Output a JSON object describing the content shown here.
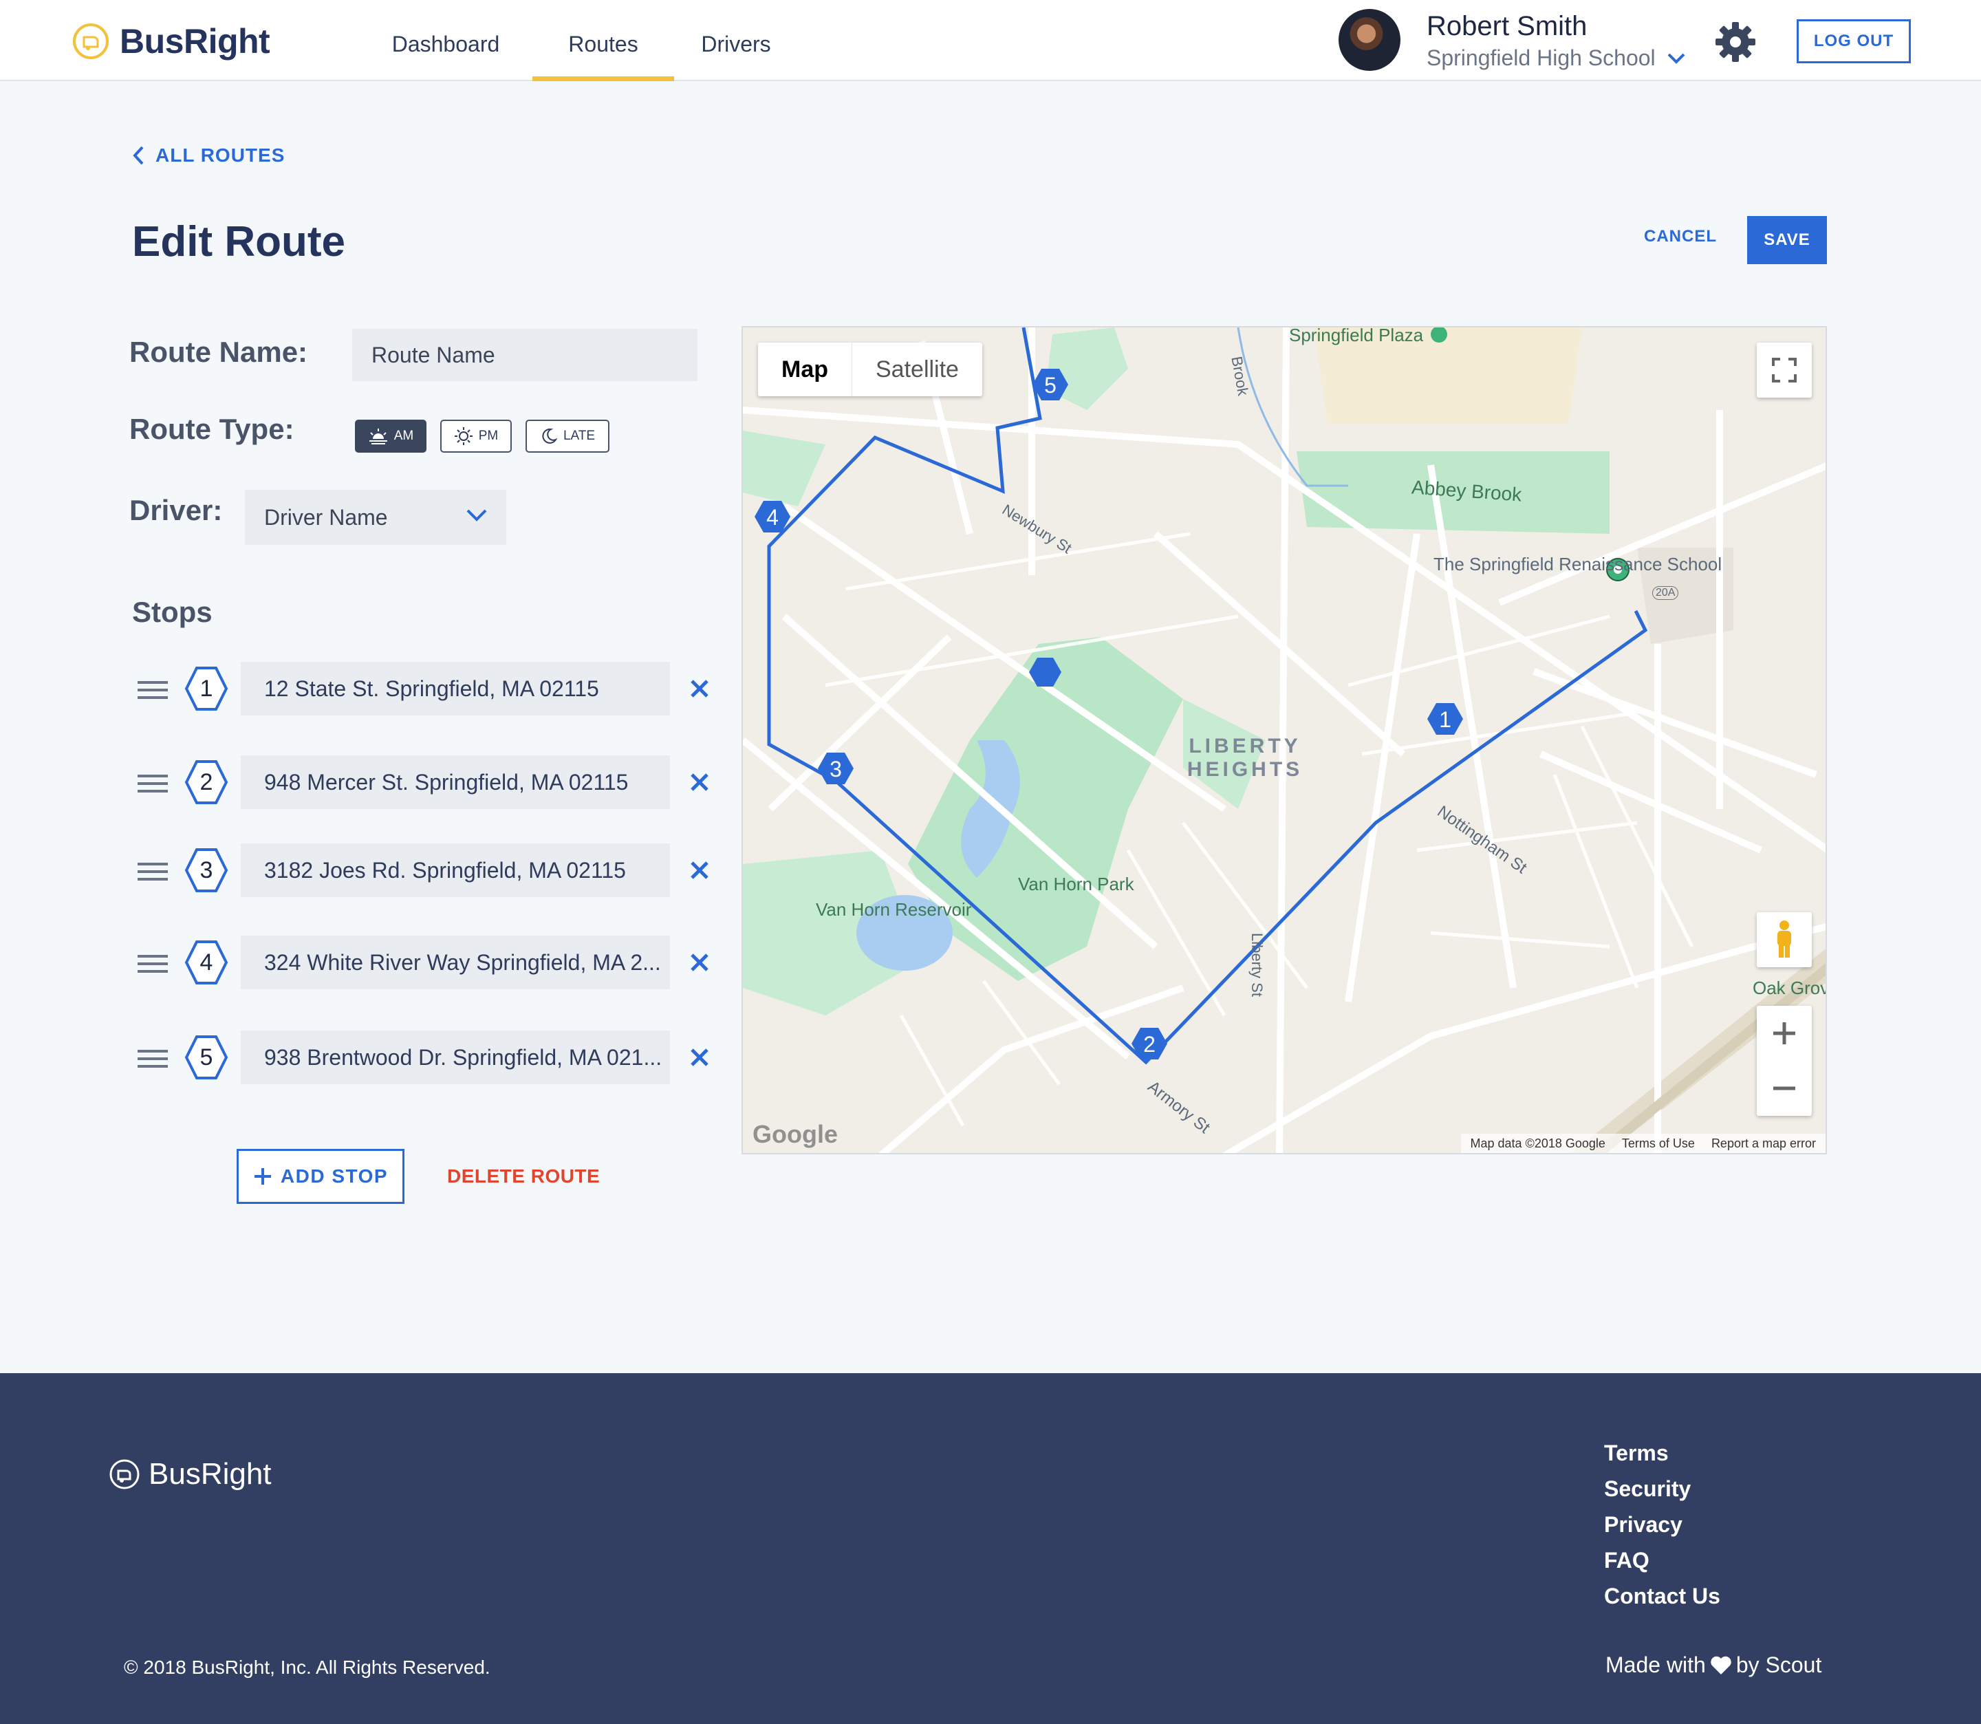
{
  "header": {
    "brand": "BusRight",
    "nav": [
      {
        "label": "Dashboard",
        "active": false
      },
      {
        "label": "Routes",
        "active": true
      },
      {
        "label": "Drivers",
        "active": false
      }
    ],
    "user": {
      "name": "Robert Smith",
      "school": "Springfield High School"
    },
    "logout_label": "LOG OUT"
  },
  "page": {
    "back_label": "ALL ROUTES",
    "title": "Edit Route",
    "cancel_label": "CANCEL",
    "save_label": "SAVE"
  },
  "form": {
    "route_name_label": "Route Name:",
    "route_name_value": "Route Name",
    "route_type_label": "Route Type:",
    "route_types": [
      {
        "label": "AM",
        "icon": "sunrise-icon",
        "selected": true
      },
      {
        "label": "PM",
        "icon": "sun-icon",
        "selected": false
      },
      {
        "label": "LATE",
        "icon": "moon-icon",
        "selected": false
      }
    ],
    "driver_label": "Driver:",
    "driver_value": "Driver Name"
  },
  "stops": {
    "title": "Stops",
    "items": [
      {
        "number": "1",
        "address": "12 State St. Springfield, MA 02115"
      },
      {
        "number": "2",
        "address": "948 Mercer St. Springfield, MA 02115"
      },
      {
        "number": "3",
        "address": "3182 Joes Rd. Springfield, MA 02115"
      },
      {
        "number": "4",
        "address": "324 White River Way Springfield, MA 2..."
      },
      {
        "number": "5",
        "address": "938 Brentwood Dr. Springfield, MA 021..."
      }
    ],
    "add_label": "ADD STOP",
    "delete_label": "DELETE ROUTE"
  },
  "map": {
    "toggle": [
      "Map",
      "Satellite"
    ],
    "active_toggle": "Map",
    "labels": {
      "plaza": "Springfield Plaza",
      "brook": "Abbey Brook",
      "school": "The Springfield Renaissance School",
      "district": "LIBERTY HEIGHTS",
      "park": "Van Horn Park",
      "reservoir": "Van Horn Reservoir",
      "oak": "Oak Grov of Spr",
      "liberty_st": "Liberty St",
      "nottingham": "Nottingham St",
      "armory": "Armory St",
      "newbury": "Newbury St",
      "brook_road": "Brook",
      "route20a": "20A"
    },
    "pins": [
      "1",
      "2",
      "3",
      "4",
      "5"
    ],
    "footer": [
      "Map data ©2018 Google",
      "Terms of Use",
      "Report a map error"
    ],
    "logo": "Google",
    "route_color": "#2a69d6"
  },
  "footer": {
    "brand": "BusRight",
    "links": [
      "Terms",
      "Security",
      "Privacy",
      "FAQ",
      "Contact Us"
    ],
    "copyright": "© 2018 BusRight, Inc. All Rights Reserved.",
    "made_with_prefix": "Made with",
    "made_with_suffix": "by Scout"
  },
  "colors": {
    "accent": "#2a69d6",
    "nav_indicator": "#f3c13a",
    "danger": "#e2452f",
    "footer_bg": "#323f62"
  }
}
